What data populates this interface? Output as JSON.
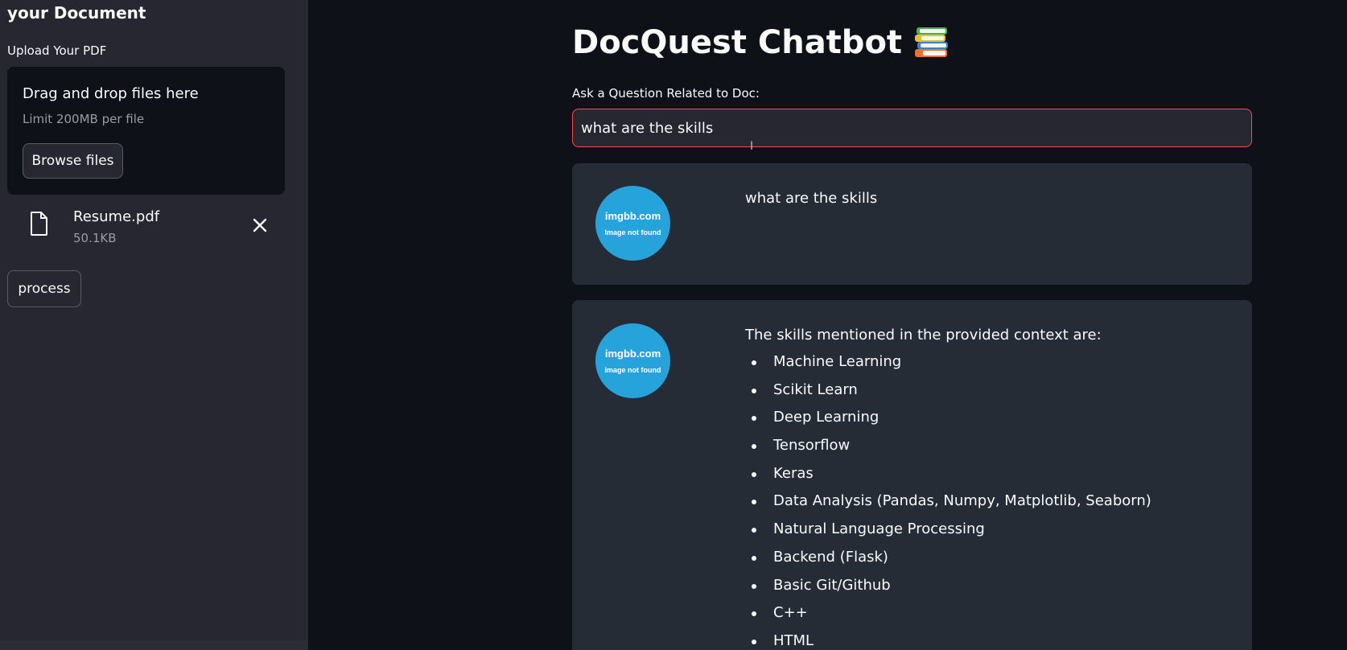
{
  "sidebar": {
    "heading": "your Document",
    "upload_label": "Upload Your PDF",
    "dropzone": {
      "title": "Drag and drop files here",
      "limit": "Limit 200MB per file",
      "browse_label": "Browse files"
    },
    "file": {
      "name": "Resume.pdf",
      "size": "50.1KB",
      "icon": "file-icon",
      "remove_icon": "close-icon"
    },
    "process_label": "process"
  },
  "main": {
    "title": "DocQuest Chatbot",
    "title_icon": "books-icon",
    "question_label": "Ask a Question Related to Doc:",
    "question_value": "what are the skills",
    "messages": [
      {
        "role": "user",
        "avatar_text": "imgbb.com",
        "avatar_subtext": "Image not found",
        "text": "what are the skills"
      },
      {
        "role": "bot",
        "avatar_text": "imgbb.com",
        "avatar_subtext": "Image not found",
        "text": "The skills mentioned in the provided context are:",
        "list": [
          "Machine Learning",
          "Scikit Learn",
          "Deep Learning",
          "Tensorflow",
          "Keras",
          "Data Analysis (Pandas, Numpy, Matplotlib, Seaborn)",
          "Natural Language Processing",
          "Backend (Flask)",
          "Basic Git/Github",
          "C++",
          "HTML"
        ]
      }
    ]
  },
  "colors": {
    "background": "#0e1117",
    "sidebar": "#262730",
    "card": "#262c36",
    "input_border_focus": "#ff4b4b",
    "avatar": "#27a3dc"
  }
}
